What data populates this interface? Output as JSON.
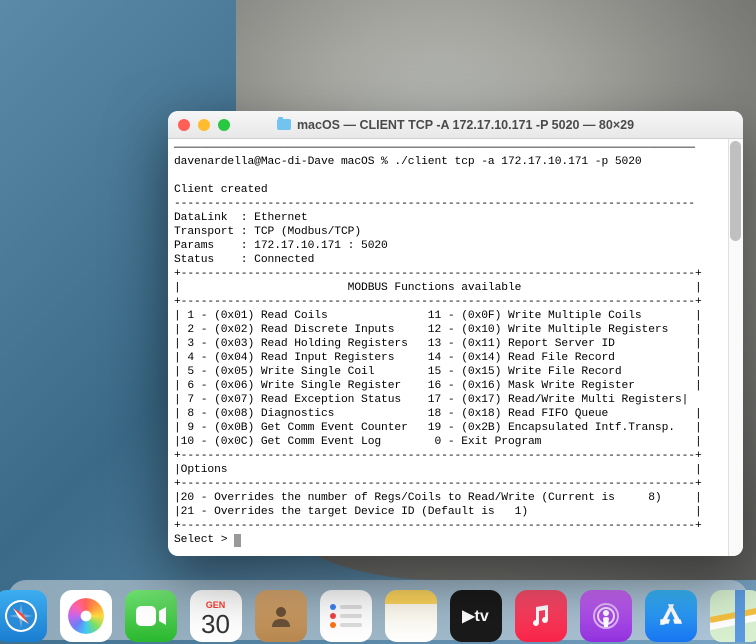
{
  "window": {
    "title": "macOS — CLIENT TCP -A 172.17.10.171 -P 5020 — 80×29"
  },
  "terminal": {
    "divider_top": "——————————————————————————————————————————————————————————————————————————————",
    "prompt_line": "davenardella@Mac-di-Dave macOS % ./client tcp -a 172.17.10.171 -p 5020",
    "blank1": "",
    "client_created": "Client created",
    "dash_divider": "------------------------------------------------------------------------------",
    "datalink": "DataLink  : Ethernet",
    "transport": "Transport : TCP (Modbus/TCP)",
    "params": "Params    : 172.17.10.171 : 5020",
    "status": "Status    : Connected",
    "border_top": "+-----------------------------------------------------------------------------+",
    "header": "|                         MODBUS Functions available                          |",
    "border_mid": "+-----------------------------------------------------------------------------+",
    "fn1": "| 1 - (0x01) Read Coils               11 - (0x0F) Write Multiple Coils        |",
    "fn2": "| 2 - (0x02) Read Discrete Inputs     12 - (0x10) Write Multiple Registers    |",
    "fn3": "| 3 - (0x03) Read Holding Registers   13 - (0x11) Report Server ID            |",
    "fn4": "| 4 - (0x04) Read Input Registers     14 - (0x14) Read File Record            |",
    "fn5": "| 5 - (0x05) Write Single Coil        15 - (0x15) Write File Record           |",
    "fn6": "| 6 - (0x06) Write Single Register    16 - (0x16) Mask Write Register         |",
    "fn7": "| 7 - (0x07) Read Exception Status    17 - (0x17) Read/Write Multi Registers|",
    "fn8": "| 8 - (0x08) Diagnostics              18 - (0x18) Read FIFO Queue             |",
    "fn9": "| 9 - (0x0B) Get Comm Event Counter   19 - (0x2B) Encapsulated Intf.Transp.   |",
    "fn10": "|10 - (0x0C) Get Comm Event Log        0 - Exit Program                       |",
    "border_mid2": "+-----------------------------------------------------------------------------+",
    "options": "|Options                                                                      |",
    "border_mid3": "+-----------------------------------------------------------------------------+",
    "opt20": "|20 - Overrides the number of Regs/Coils to Read/Write (Current is     8)     |",
    "opt21": "|21 - Overrides the target Device ID (Default is   1)                         |",
    "border_bot": "+-----------------------------------------------------------------------------+",
    "select": "Select > "
  },
  "calendar": {
    "month": "GEN",
    "day": "30"
  },
  "tv_label": "▶tv"
}
